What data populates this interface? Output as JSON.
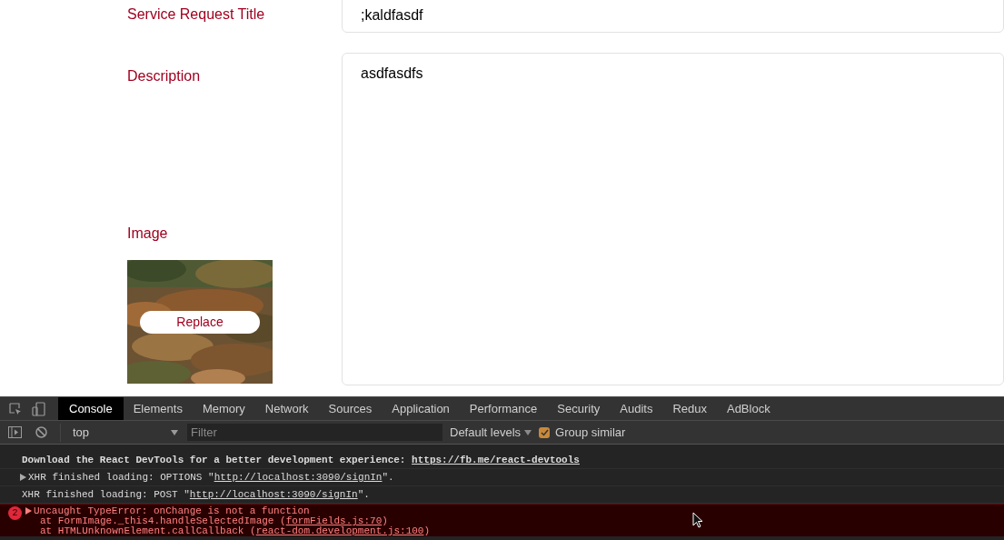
{
  "form": {
    "fields": [
      {
        "kind": "input",
        "label": "Service Request Title",
        "value": ";kaldfasdf"
      },
      {
        "kind": "textarea",
        "label": "Description",
        "value": "asdfasdfs"
      }
    ],
    "image": {
      "label": "Image",
      "button": "Replace"
    }
  },
  "devtools": {
    "tabs": [
      {
        "label": "Console",
        "selected": true
      },
      {
        "label": "Elements",
        "selected": false
      },
      {
        "label": "Memory",
        "selected": false
      },
      {
        "label": "Network",
        "selected": false
      },
      {
        "label": "Sources",
        "selected": false
      },
      {
        "label": "Application",
        "selected": false
      },
      {
        "label": "Performance",
        "selected": false
      },
      {
        "label": "Security",
        "selected": false
      },
      {
        "label": "Audits",
        "selected": false
      },
      {
        "label": "Redux",
        "selected": false
      },
      {
        "label": "AdBlock",
        "selected": false
      }
    ],
    "toolbar": {
      "context": "top",
      "filter_placeholder": "Filter",
      "levels": "Default levels",
      "group_similar": {
        "label": "Group similar",
        "checked": true
      }
    },
    "messages": [
      {
        "kind": "log",
        "bold": true,
        "expandable": false,
        "parts": [
          {
            "kind": "text",
            "text": "Download the React DevTools for a better development experience: "
          },
          {
            "kind": "link",
            "text": "https://fb.me/react-devtools"
          }
        ]
      },
      {
        "kind": "log",
        "bold": false,
        "expandable": true,
        "parts": [
          {
            "kind": "text",
            "text": "XHR finished loading: OPTIONS \""
          },
          {
            "kind": "link",
            "text": "http://localhost:3090/signIn"
          },
          {
            "kind": "text",
            "text": "\"."
          }
        ]
      },
      {
        "kind": "log",
        "bold": false,
        "expandable": false,
        "parts": [
          {
            "kind": "text",
            "text": "XHR finished loading: POST \""
          },
          {
            "kind": "link",
            "text": "http://localhost:3090/signIn"
          },
          {
            "kind": "text",
            "text": "\"."
          }
        ]
      },
      {
        "kind": "error",
        "count": "2",
        "bold": false,
        "expandable": true,
        "parts": [
          {
            "kind": "text",
            "text": "Uncaught TypeError: onChange is not a function"
          }
        ],
        "stack": [
          [
            {
              "kind": "text",
              "text": "at FormImage._this4.handleSelectedImage ("
            },
            {
              "kind": "link",
              "text": "formFields.js:70"
            },
            {
              "kind": "text",
              "text": ")"
            }
          ],
          [
            {
              "kind": "text",
              "text": "at HTMLUnknownElement.callCallback ("
            },
            {
              "kind": "link",
              "text": "react-dom.development.js:100"
            },
            {
              "kind": "text",
              "text": ")"
            }
          ]
        ]
      }
    ]
  }
}
